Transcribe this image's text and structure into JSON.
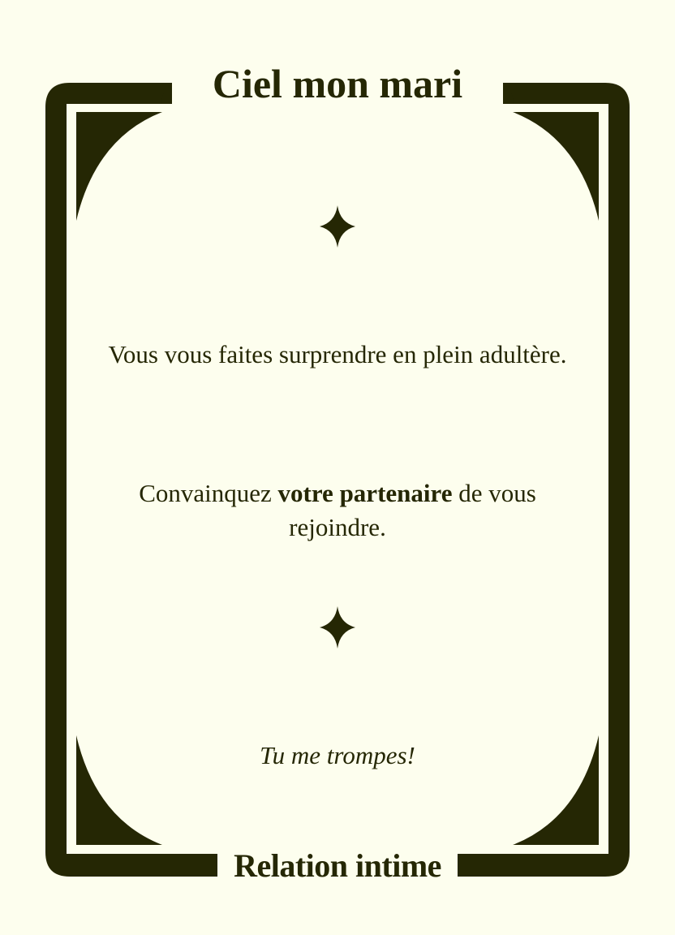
{
  "card": {
    "title": "Ciel mon mari",
    "category": "Relation intime",
    "situation": "Vous vous faites surprendre en plein adultère.",
    "instruction": {
      "before": "Convainquez ",
      "emphasis": "votre partenaire",
      "after": " de vous rejoindre."
    },
    "quote": "Tu me trompes!",
    "colors": {
      "ink": "#252704",
      "background": "#fdfeee"
    },
    "ornament_icon": "four-point-star-icon"
  }
}
